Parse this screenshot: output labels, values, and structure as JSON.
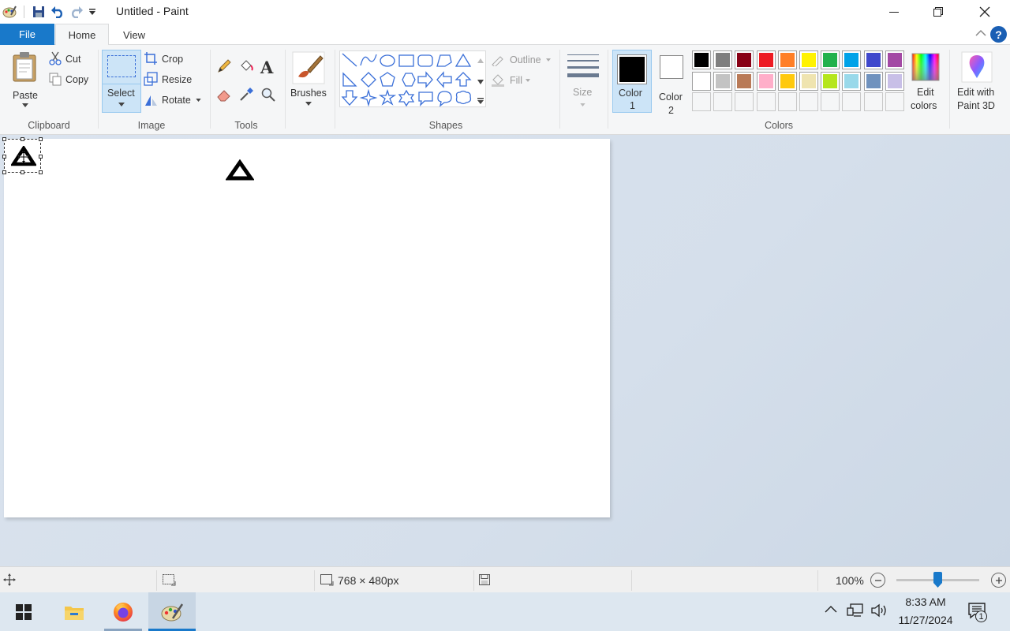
{
  "window": {
    "title": "Untitled - Paint",
    "qat_icons": [
      "paint-app-icon",
      "save-icon",
      "undo-icon",
      "redo-icon",
      "customize-dropdown-icon"
    ]
  },
  "tabs": {
    "file": "File",
    "home": "Home",
    "view": "View"
  },
  "ribbon": {
    "clipboard": {
      "label": "Clipboard",
      "paste": "Paste",
      "cut": "Cut",
      "copy": "Copy"
    },
    "image": {
      "label": "Image",
      "select": "Select",
      "crop": "Crop",
      "resize": "Resize",
      "rotate": "Rotate"
    },
    "tools": {
      "label": "Tools"
    },
    "brushes": {
      "label": "Brushes"
    },
    "shapes": {
      "label": "Shapes",
      "outline": "Outline",
      "fill": "Fill"
    },
    "size": {
      "label": "Size"
    },
    "colors": {
      "label": "Colors",
      "color1": "Color",
      "color1_num": "1",
      "color2": "Color",
      "color2_num": "2",
      "edit_colors_1": "Edit",
      "edit_colors_2": "colors",
      "paint3d_1": "Edit with",
      "paint3d_2": "Paint 3D",
      "color1_value": "#000000",
      "color2_value": "#ffffff",
      "palette_row1": [
        "#000000",
        "#7f7f7f",
        "#880015",
        "#ed1c24",
        "#ff7f27",
        "#fff200",
        "#22b14c",
        "#00a2e8",
        "#3f48cc",
        "#a349a4"
      ],
      "palette_row2": [
        "#ffffff",
        "#c3c3c3",
        "#b97a57",
        "#ffaec9",
        "#ffc90e",
        "#efe4b0",
        "#b5e61d",
        "#99d9ea",
        "#7092be",
        "#c8bfe7"
      ]
    }
  },
  "statusbar": {
    "canvas_size": "768 × 480px",
    "zoom": "100%",
    "zoom_level": 0.5
  },
  "taskbar": {
    "time": "8:33 AM",
    "date": "11/27/2024",
    "notification_count": "1"
  }
}
